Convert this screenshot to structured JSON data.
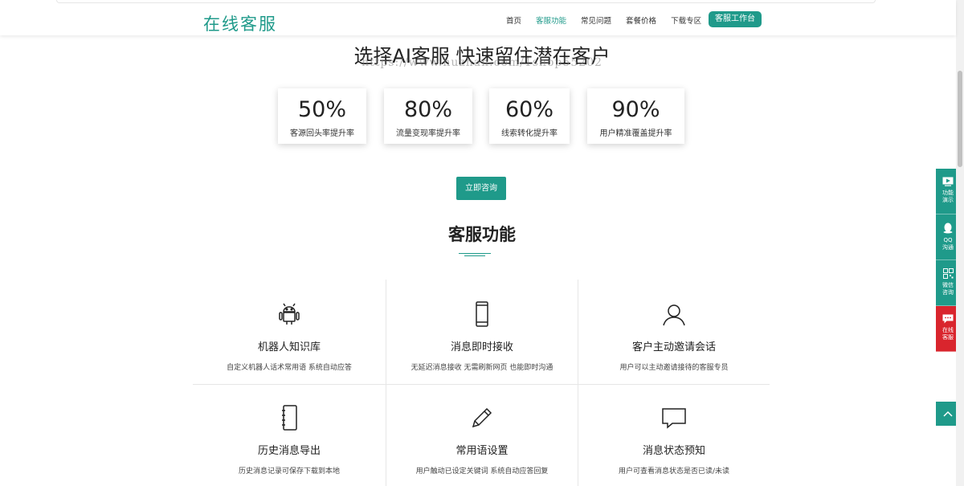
{
  "header": {
    "logo": "在线客服",
    "nav": [
      {
        "label": "首页",
        "active": false
      },
      {
        "label": "客服功能",
        "active": true
      },
      {
        "label": "常见问题",
        "active": false
      },
      {
        "label": "套餐价格",
        "active": false
      },
      {
        "label": "下载专区",
        "active": false
      }
    ],
    "workbench_label": "客服工作台"
  },
  "hero": {
    "title": "选择AI客服 快速留住潜在客户",
    "watermark": "https://www.huzhan.com/1shop55202"
  },
  "stats": [
    {
      "value": "50%",
      "label": "客源回头率提升率"
    },
    {
      "value": "80%",
      "label": "流量变现率提升率"
    },
    {
      "value": "60%",
      "label": "线索转化提升率"
    },
    {
      "value": "90%",
      "label": "用户精准覆盖提升率"
    }
  ],
  "consult_label": "立即咨询",
  "section_title": "客服功能",
  "features": [
    {
      "icon": "android-icon",
      "title": "机器人知识库",
      "desc": "自定义机器人话术常用语 系统自动应答"
    },
    {
      "icon": "mobile-icon",
      "title": "消息即时接收",
      "desc": "无延迟消息接收 无需刷新网页 也能即时沟通"
    },
    {
      "icon": "user-icon",
      "title": "客户主动邀请会话",
      "desc": "用户可以主动邀请接待的客服专员"
    },
    {
      "icon": "notebook-icon",
      "title": "历史消息导出",
      "desc": "历史消息记录可保存下载到本地"
    },
    {
      "icon": "pencil-icon",
      "title": "常用语设置",
      "desc": "用户触动已设定关键词 系统自动应答回复"
    },
    {
      "icon": "chat-bubble-icon",
      "title": "消息状态预知",
      "desc": "用户可查看消息状态是否已读/未读"
    }
  ],
  "side_toolbar": [
    {
      "icon": "video-icon",
      "line1": "功能",
      "line2": "演示"
    },
    {
      "icon": "qq-icon",
      "line1": "QQ",
      "line2": "沟通"
    },
    {
      "icon": "qrcode-icon",
      "line1": "微信",
      "line2": "咨询"
    },
    {
      "icon": "message-icon",
      "line1": "在线",
      "line2": "客服"
    }
  ],
  "colors": {
    "accent": "#1f9a8a",
    "red": "#d9252d"
  }
}
